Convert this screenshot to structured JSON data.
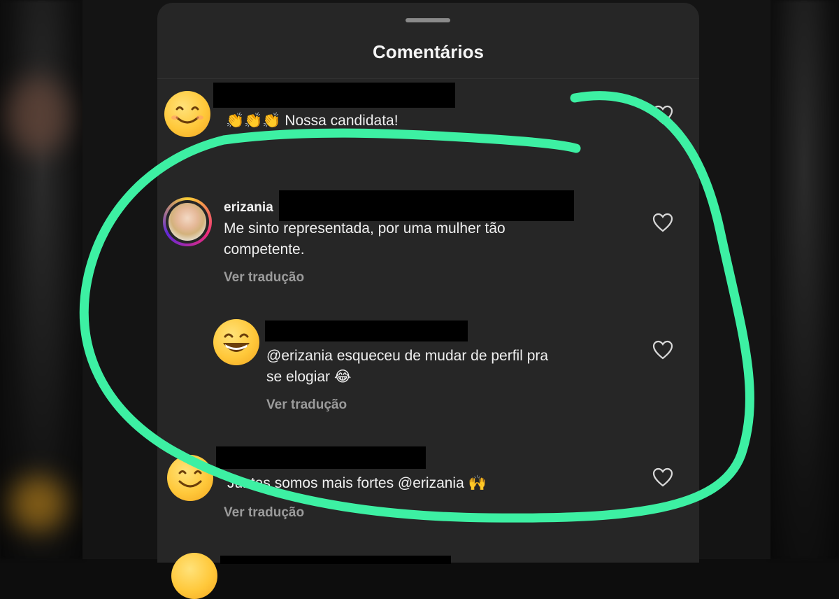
{
  "sheet": {
    "title": "Comentários"
  },
  "comments": [
    {
      "text": "👏👏👏 Nossa candidata!",
      "liked": false
    },
    {
      "username": "erizania",
      "text_line1": "Me sinto representada, por uma mulher tão",
      "text_line2": "competente.",
      "translate": "Ver tradução",
      "liked": false
    },
    {
      "text_line1": "@erizania esqueceu de mudar de perfil pra",
      "text_line2": "se elogiar 😂",
      "translate": "Ver tradução",
      "liked": false
    },
    {
      "text": "Juntas somos mais fortes @erizania 🙌",
      "translate": "Ver tradução",
      "liked": false
    }
  ],
  "annotation": {
    "color": "#3df0a3"
  },
  "colors": {
    "sheet": "#262626",
    "text": "#efefef",
    "muted": "#9b9b9b"
  }
}
